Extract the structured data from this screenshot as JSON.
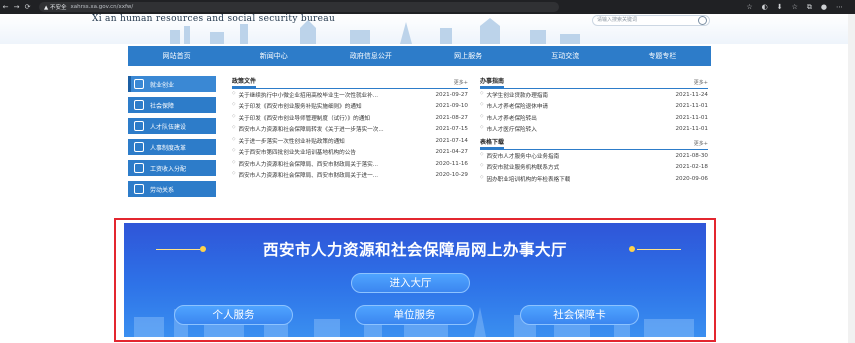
{
  "browser": {
    "back": "←",
    "forward": "→",
    "reload": "⟳",
    "warning": "▲ 不安全",
    "url": "xahrss.xa.gov.cn/xxfw/",
    "icons": [
      "☆",
      "◐",
      "⬇",
      "☆",
      "⧉",
      "●",
      "⋯"
    ]
  },
  "header": {
    "bureau_en": "Xi an human resources and social security bureau",
    "search_placeholder": "请输入搜索关键词"
  },
  "nav": [
    "网站首页",
    "新闻中心",
    "政府信息公开",
    "网上服务",
    "互动交流",
    "专题专栏"
  ],
  "sidebar": [
    "就业创业",
    "社会保障",
    "人才队伍建设",
    "人事制度改革",
    "工资收入分配",
    "劳动关系"
  ],
  "policy": {
    "title": "政策文件",
    "more": "更多+",
    "items": [
      {
        "text": "关于继续执行中小微企业招用高校毕业生一次性就业补...",
        "date": "2021-09-27"
      },
      {
        "text": "关于印发《西安市创业服务补贴实施细则》的通知",
        "date": "2021-09-10"
      },
      {
        "text": "关于印发《西安市创业导师管理制度（试行）》的通知",
        "date": "2021-08-27"
      },
      {
        "text": "西安市人力资源和社会保障局转发《关于进一步落实一次...",
        "date": "2021-07-15"
      },
      {
        "text": "关于进一步落实一次性创业补贴政策的通知",
        "date": "2021-07-14"
      },
      {
        "text": "关于西安市第四批创业失业培训基地机构的公告",
        "date": "2021-04-27"
      },
      {
        "text": "西安市人力资源和社会保障局、西安市财政局关于落实...",
        "date": "2020-11-16"
      },
      {
        "text": "西安市人力资源和社会保障局、西安市财政局关于进一...",
        "date": "2020-10-29"
      }
    ]
  },
  "guide": {
    "title": "办事指南",
    "more": "更多+",
    "items": [
      {
        "text": "大学生创业贷款办理指南",
        "date": "2021-11-24"
      },
      {
        "text": "市人才养老保险退休申请",
        "date": "2021-11-01"
      },
      {
        "text": "市人才养老保险转出",
        "date": "2021-11-01"
      },
      {
        "text": "市人才医疗保险转入",
        "date": "2021-11-01"
      }
    ]
  },
  "forms": {
    "title": "表格下载",
    "more": "更多+",
    "items": [
      {
        "text": "西安市人才服务中心业务指南",
        "date": "2021-08-30"
      },
      {
        "text": "西安市就业服务机构联系方式",
        "date": "2021-02-18"
      },
      {
        "text": "因办职业培训机构的年检表格下载",
        "date": "2020-09-06"
      }
    ]
  },
  "banner": {
    "title": "西安市人力资源和社会保障局网上办事大厅",
    "enter": "进入大厅",
    "services": [
      "个人服务",
      "单位服务",
      "社会保障卡"
    ]
  },
  "colors": {
    "nav_blue": "#2d7cc9",
    "banner_blue": "#2f55d8",
    "highlight_red": "#e3262f"
  }
}
